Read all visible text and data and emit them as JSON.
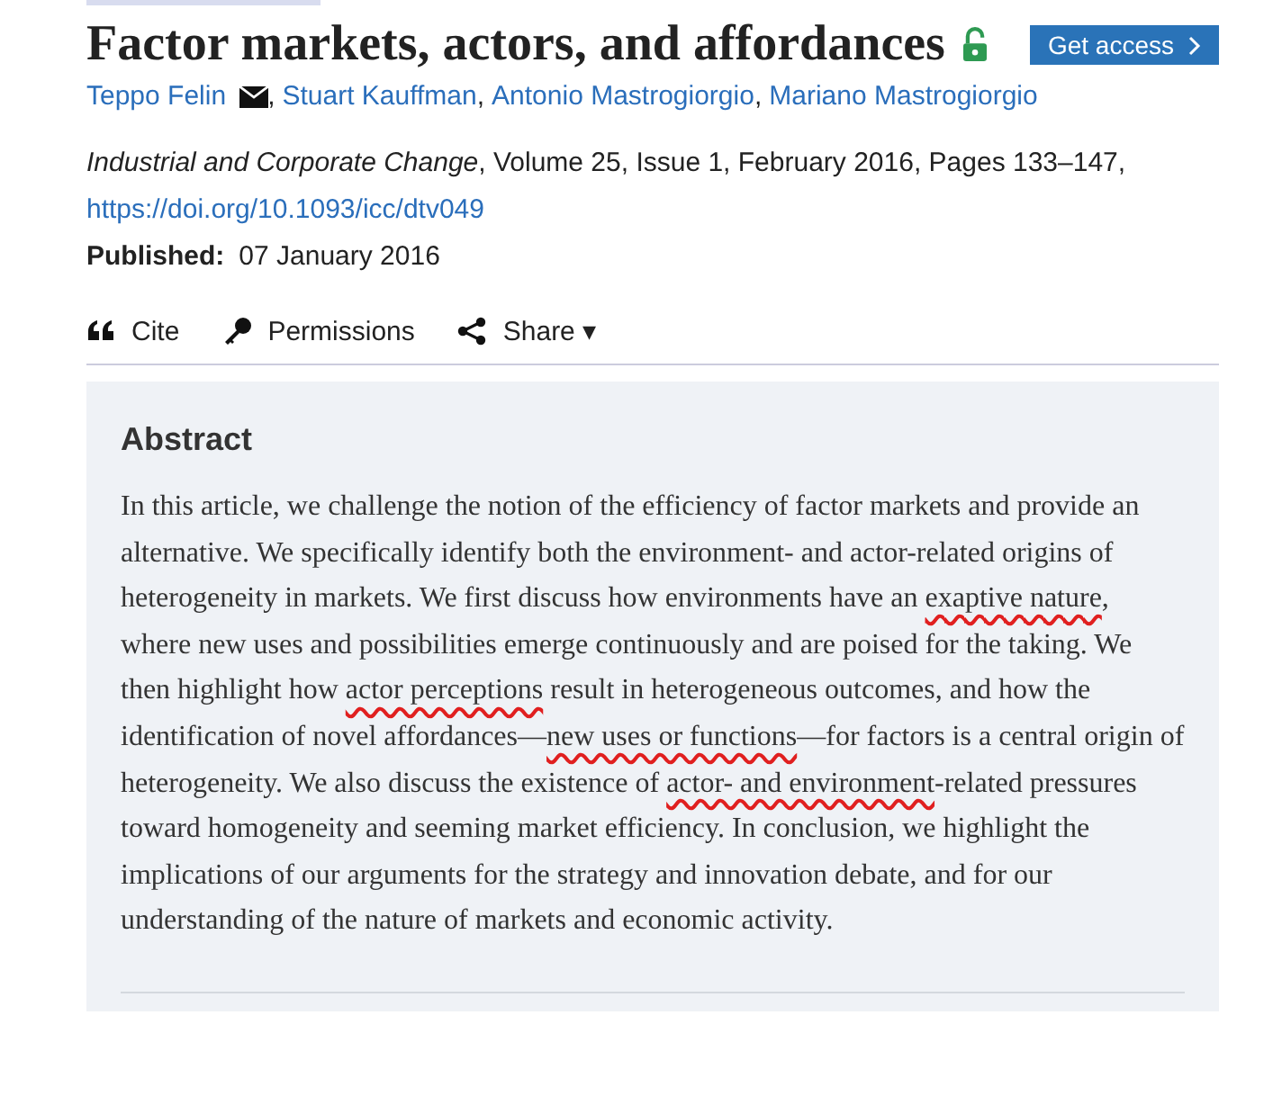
{
  "title": "Factor markets, actors, and affordances",
  "access": {
    "open": true,
    "button": "Get access"
  },
  "authors": [
    {
      "name": "Teppo Felin",
      "email": true,
      "separator": ","
    },
    {
      "name": "Stuart Kauffman",
      "email": false,
      "separator": ","
    },
    {
      "name": "Antonio Mastrogiorgio",
      "email": false,
      "separator": ","
    },
    {
      "name": "Mariano Mastrogiorgio",
      "email": false
    }
  ],
  "citation": {
    "journal": "Industrial and Corporate Change",
    "details": ", Volume 25, Issue 1, February 2016, Pages 133–147,",
    "doi": "https://doi.org/10.1093/icc/dtv049"
  },
  "published": {
    "label": "Published:",
    "date": "07 January 2016"
  },
  "tools": [
    {
      "kind": "cite",
      "label": "Cite"
    },
    {
      "kind": "permissions",
      "label": "Permissions"
    },
    {
      "kind": "share",
      "label": "Share ▾"
    }
  ],
  "abstract": {
    "heading": "Abstract",
    "segments": [
      {
        "text": "In this article, we challenge the notion of the efficiency of factor markets and provide an alternative. We specifically identify both the environment- and actor-related origins of heterogeneity in markets. We first discuss how environments have an ",
        "underlined": false
      },
      {
        "text": "exaptive nature",
        "underlined": true
      },
      {
        "text": ", where new uses and possibilities emerge continuously and are poised for the taking. We then highlight how ",
        "underlined": false
      },
      {
        "text": "actor perceptions",
        "underlined": true
      },
      {
        "text": " result in heterogeneous outcomes, and how the identification of novel affordances—",
        "underlined": false
      },
      {
        "text": "new uses or functions",
        "underlined": true
      },
      {
        "text": "—for factors is a central origin of heterogeneity. We also discuss the existence of ",
        "underlined": false
      },
      {
        "text": "actor- and environment",
        "underlined": true
      },
      {
        "text": "-related pressures toward homogeneity and seeming market efficiency. In conclusion, we highlight the implications of our arguments for the strategy and innovation debate, and for our understanding of the nature of markets and economic activity.",
        "underlined": false
      }
    ]
  }
}
